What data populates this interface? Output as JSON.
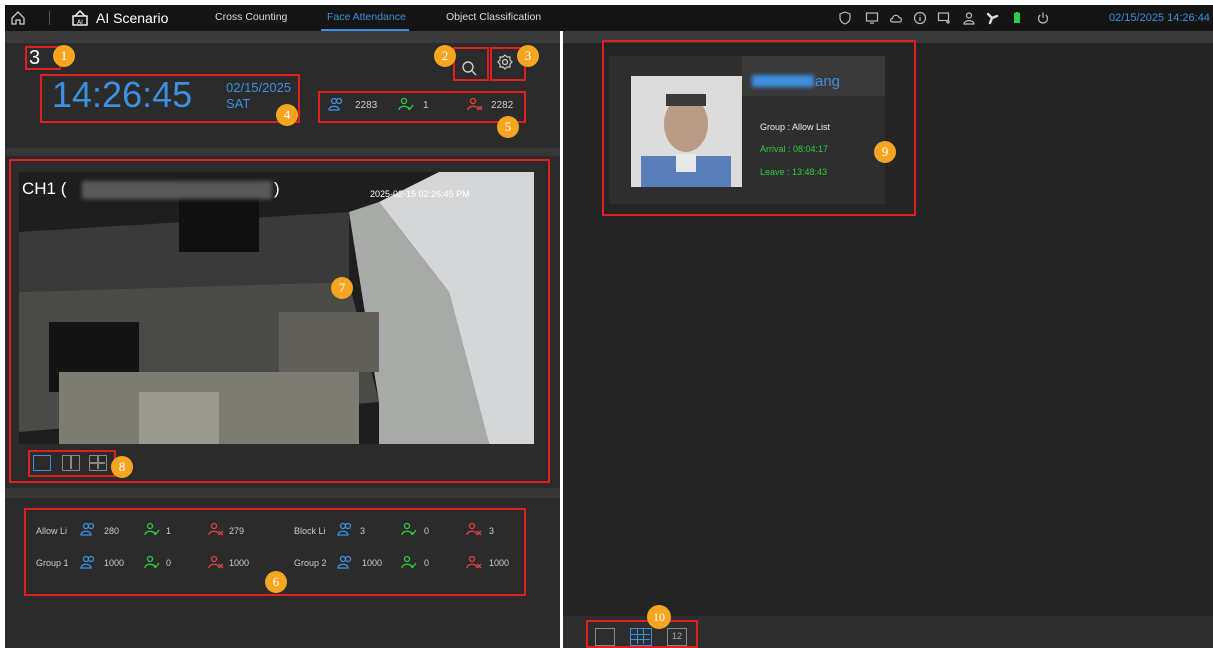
{
  "topbar": {
    "app_title": "AI Scenario",
    "tabs": [
      {
        "label": "Cross Counting"
      },
      {
        "label": "Face Attendance"
      },
      {
        "label": "Object Classification"
      }
    ],
    "datetime": "02/15/2025 14:26:44",
    "icons": [
      "home-icon",
      "ai-scenario-icon",
      "shield-icon",
      "monitor-icon",
      "cloud-icon",
      "info-icon",
      "display-icon",
      "user-icon",
      "fan-icon",
      "battery-icon",
      "power-icon"
    ]
  },
  "left": {
    "mode_number": "3",
    "clock": "14:26:45",
    "date": "02/15/2025",
    "day": "SAT",
    "stats": {
      "total": "2283",
      "present": "1",
      "absent": "2282"
    },
    "video": {
      "channel_prefix": "CH1 (",
      "channel_suffix": ")",
      "timestamp": "2025-02-15 02:26:45 PM"
    },
    "groups": [
      {
        "label": "Allow Li",
        "total": "280",
        "present": "1",
        "absent": "279"
      },
      {
        "label": "Block Li",
        "total": "3",
        "present": "0",
        "absent": "3"
      },
      {
        "label": "Group 1",
        "total": "1000",
        "present": "0",
        "absent": "1000"
      },
      {
        "label": "Group 2",
        "total": "1000",
        "present": "0",
        "absent": "1000"
      }
    ]
  },
  "card": {
    "name_visible": "ang",
    "group": "Group : Allow List",
    "arrival": "Arrival : 08:04:17",
    "leave": "Leave : 13:48:43"
  },
  "bottom": {
    "grid_number": "12"
  },
  "badges": [
    "1",
    "2",
    "3",
    "4",
    "5",
    "6",
    "7",
    "8",
    "9",
    "10"
  ],
  "colors": {
    "accent": "#3d8fe0",
    "present": "#2ecc40",
    "absent": "#e24040",
    "annotation": "#e02020",
    "badge": "#f4a522"
  }
}
